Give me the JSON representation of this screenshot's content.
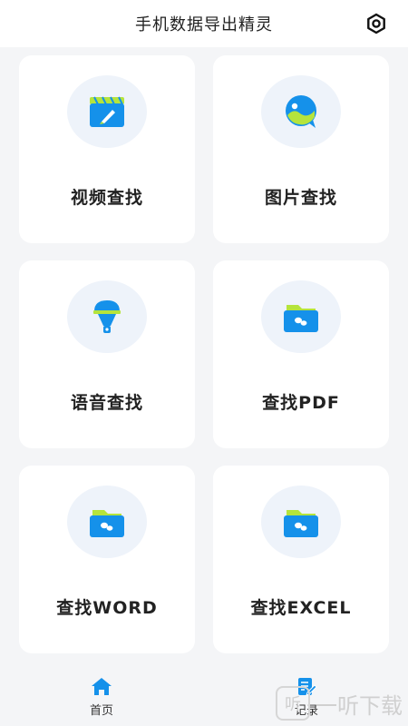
{
  "header": {
    "title": "手机数据导出精灵"
  },
  "cards": [
    {
      "label": "视频查找",
      "icon": "video-clapper-icon"
    },
    {
      "label": "图片查找",
      "icon": "image-chat-icon"
    },
    {
      "label": "语音查找",
      "icon": "voice-lamp-icon"
    },
    {
      "label": "查找PDF",
      "icon": "pdf-folder-icon"
    },
    {
      "label": "查找WORD",
      "icon": "word-folder-icon"
    },
    {
      "label": "查找EXCEL",
      "icon": "excel-folder-icon"
    }
  ],
  "tabs": [
    {
      "label": "首页",
      "icon": "home-icon",
      "active": true
    },
    {
      "label": "记录",
      "icon": "document-edit-icon",
      "active": false
    }
  ],
  "watermark": {
    "glyph": "听",
    "text": "一听下载"
  },
  "colors": {
    "accent": "#1591ea",
    "lime": "#b5e43c",
    "background": "#f4f5f7"
  }
}
